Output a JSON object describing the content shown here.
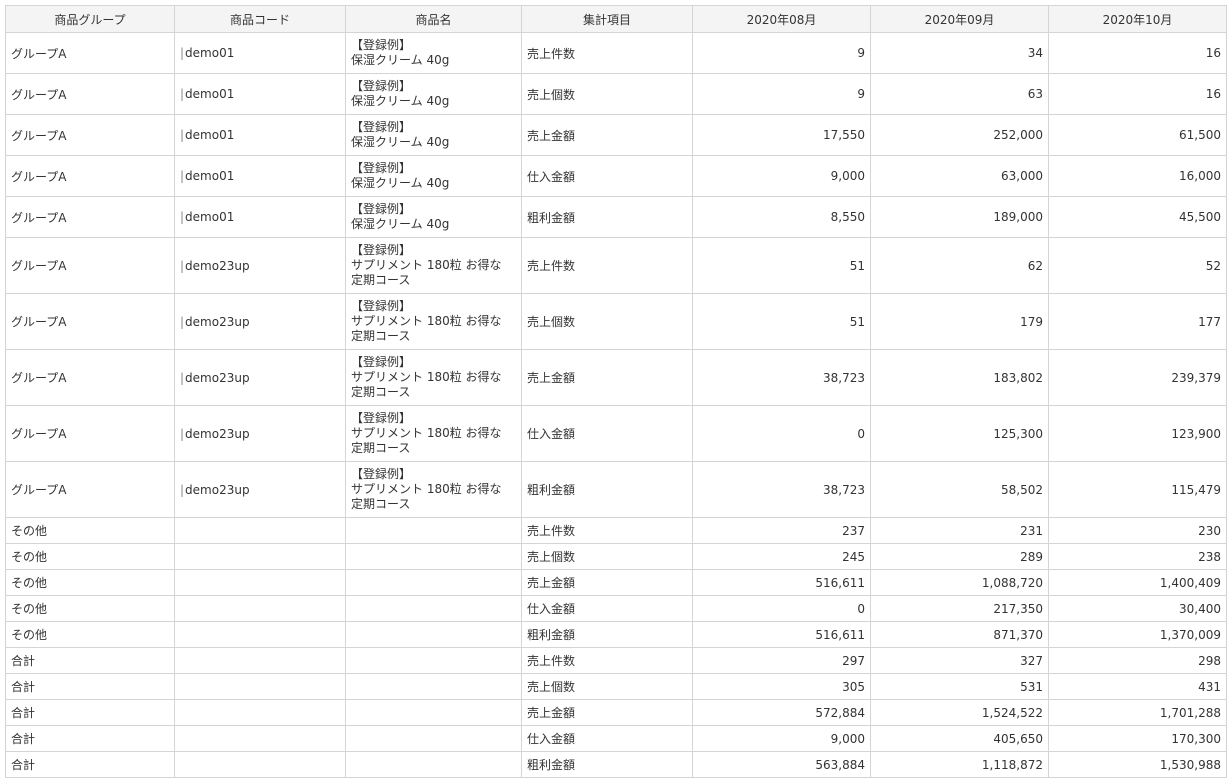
{
  "columns": [
    "商品グループ",
    "商品コード",
    "商品名",
    "集計項目",
    "2020年08月",
    "2020年09月",
    "2020年10月"
  ],
  "rows": [
    {
      "group": "グループA",
      "code": "demo01",
      "name": [
        "【登録例】",
        "保湿クリーム 40g"
      ],
      "item": "売上件数",
      "m1": "9",
      "m2": "34",
      "m3": "16"
    },
    {
      "group": "グループA",
      "code": "demo01",
      "name": [
        "【登録例】",
        "保湿クリーム 40g"
      ],
      "item": "売上個数",
      "m1": "9",
      "m2": "63",
      "m3": "16"
    },
    {
      "group": "グループA",
      "code": "demo01",
      "name": [
        "【登録例】",
        "保湿クリーム 40g"
      ],
      "item": "売上金額",
      "m1": "17,550",
      "m2": "252,000",
      "m3": "61,500"
    },
    {
      "group": "グループA",
      "code": "demo01",
      "name": [
        "【登録例】",
        "保湿クリーム 40g"
      ],
      "item": "仕入金額",
      "m1": "9,000",
      "m2": "63,000",
      "m3": "16,000"
    },
    {
      "group": "グループA",
      "code": "demo01",
      "name": [
        "【登録例】",
        "保湿クリーム 40g"
      ],
      "item": "粗利金額",
      "m1": "8,550",
      "m2": "189,000",
      "m3": "45,500"
    },
    {
      "group": "グループA",
      "code": "demo23up",
      "name": [
        "【登録例】",
        "サプリメント 180粒 お得な",
        "定期コース"
      ],
      "item": "売上件数",
      "m1": "51",
      "m2": "62",
      "m3": "52"
    },
    {
      "group": "グループA",
      "code": "demo23up",
      "name": [
        "【登録例】",
        "サプリメント 180粒 お得な",
        "定期コース"
      ],
      "item": "売上個数",
      "m1": "51",
      "m2": "179",
      "m3": "177"
    },
    {
      "group": "グループA",
      "code": "demo23up",
      "name": [
        "【登録例】",
        "サプリメント 180粒 お得な",
        "定期コース"
      ],
      "item": "売上金額",
      "m1": "38,723",
      "m2": "183,802",
      "m3": "239,379"
    },
    {
      "group": "グループA",
      "code": "demo23up",
      "name": [
        "【登録例】",
        "サプリメント 180粒 お得な",
        "定期コース"
      ],
      "item": "仕入金額",
      "m1": "0",
      "m2": "125,300",
      "m3": "123,900"
    },
    {
      "group": "グループA",
      "code": "demo23up",
      "name": [
        "【登録例】",
        "サプリメント 180粒 お得な",
        "定期コース"
      ],
      "item": "粗利金額",
      "m1": "38,723",
      "m2": "58,502",
      "m3": "115,479"
    },
    {
      "group": "その他",
      "code": "",
      "name": [],
      "item": "売上件数",
      "m1": "237",
      "m2": "231",
      "m3": "230"
    },
    {
      "group": "その他",
      "code": "",
      "name": [],
      "item": "売上個数",
      "m1": "245",
      "m2": "289",
      "m3": "238"
    },
    {
      "group": "その他",
      "code": "",
      "name": [],
      "item": "売上金額",
      "m1": "516,611",
      "m2": "1,088,720",
      "m3": "1,400,409"
    },
    {
      "group": "その他",
      "code": "",
      "name": [],
      "item": "仕入金額",
      "m1": "0",
      "m2": "217,350",
      "m3": "30,400"
    },
    {
      "group": "その他",
      "code": "",
      "name": [],
      "item": "粗利金額",
      "m1": "516,611",
      "m2": "871,370",
      "m3": "1,370,009"
    },
    {
      "group": "合計",
      "code": "",
      "name": [],
      "item": "売上件数",
      "m1": "297",
      "m2": "327",
      "m3": "298"
    },
    {
      "group": "合計",
      "code": "",
      "name": [],
      "item": "売上個数",
      "m1": "305",
      "m2": "531",
      "m3": "431"
    },
    {
      "group": "合計",
      "code": "",
      "name": [],
      "item": "売上金額",
      "m1": "572,884",
      "m2": "1,524,522",
      "m3": "1,701,288"
    },
    {
      "group": "合計",
      "code": "",
      "name": [],
      "item": "仕入金額",
      "m1": "9,000",
      "m2": "405,650",
      "m3": "170,300"
    },
    {
      "group": "合計",
      "code": "",
      "name": [],
      "item": "粗利金額",
      "m1": "563,884",
      "m2": "1,118,872",
      "m3": "1,530,988"
    }
  ]
}
